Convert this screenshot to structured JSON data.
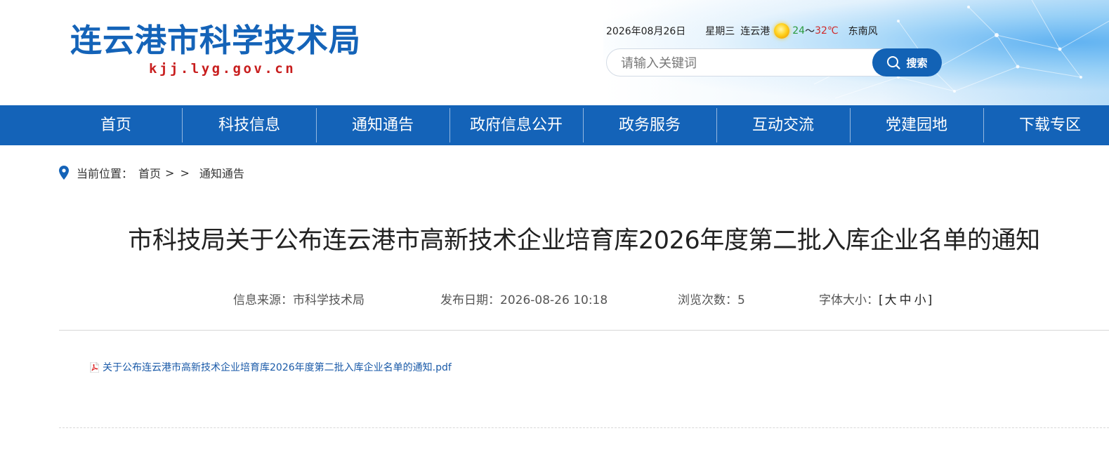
{
  "header": {
    "site_title": "连云港市科学技术局",
    "site_domain": "kjj.lyg.gov.cn"
  },
  "weather": {
    "date": "2026年08月26日",
    "weekday": "星期三",
    "city": "连云港",
    "icon": "sun-icon",
    "temp_low": "24",
    "temp_sep": "～",
    "temp_high": "32℃",
    "wind": "东南风"
  },
  "search": {
    "placeholder": "请输入关键词",
    "button_label": "搜索"
  },
  "nav": {
    "items": [
      {
        "label": "首页"
      },
      {
        "label": "科技信息"
      },
      {
        "label": "通知通告"
      },
      {
        "label": "政府信息公开"
      },
      {
        "label": "政务服务"
      },
      {
        "label": "互动交流"
      },
      {
        "label": "党建园地"
      },
      {
        "label": "下载专区"
      }
    ]
  },
  "breadcrumb": {
    "prefix": "当前位置：",
    "home": "首页",
    "sep": ">",
    "current": "通知通告"
  },
  "article": {
    "title": "市科技局关于公布连云港市高新技术企业培育库2026年度第二批入库企业名单的通知",
    "source": "信息来源：市科学技术局",
    "date": "发布日期：2026-08-26 10:18",
    "views": "浏览次数：5",
    "font_size_label": "字体大小：",
    "font_open": "[",
    "font_large": "大",
    "font_medium": "中",
    "font_small": "小",
    "font_close": "]",
    "attachment": "关于公布连云港市高新技术企业培育库2026年度第二批入库企业名单的通知.pdf"
  },
  "colors": {
    "brand_blue": "#1463b8",
    "domain_red": "#c81e1e",
    "link_blue": "#1a5aa8"
  }
}
